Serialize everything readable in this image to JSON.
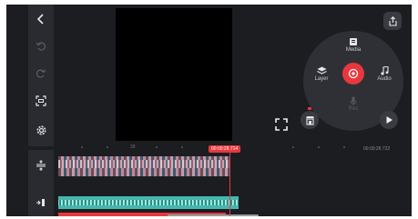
{
  "wheel": {
    "media_label": "Media",
    "layer_label": "Layer",
    "audio_label": "Audio",
    "rec_label": "Rec"
  },
  "timeline": {
    "current_time": "00:00:28.714",
    "total_time": "00:00:28.722",
    "ruler_label": "28"
  },
  "colors": {
    "accent": "#e8383d",
    "audio_track": "#46b7ae",
    "panel": "#2a2b30",
    "background": "#1c1d21"
  },
  "icons": {
    "back": "chevron-left-icon",
    "undo": "undo-icon",
    "redo": "redo-icon",
    "screenshot": "capture-frame-icon",
    "settings": "gear-icon",
    "export": "share-export-icon",
    "store": "asset-store-icon",
    "play": "play-icon",
    "fullscreen": "fullscreen-icon",
    "layers_toggle": "layer-adjust-icon",
    "audio_toggle": "audio-track-icon"
  }
}
